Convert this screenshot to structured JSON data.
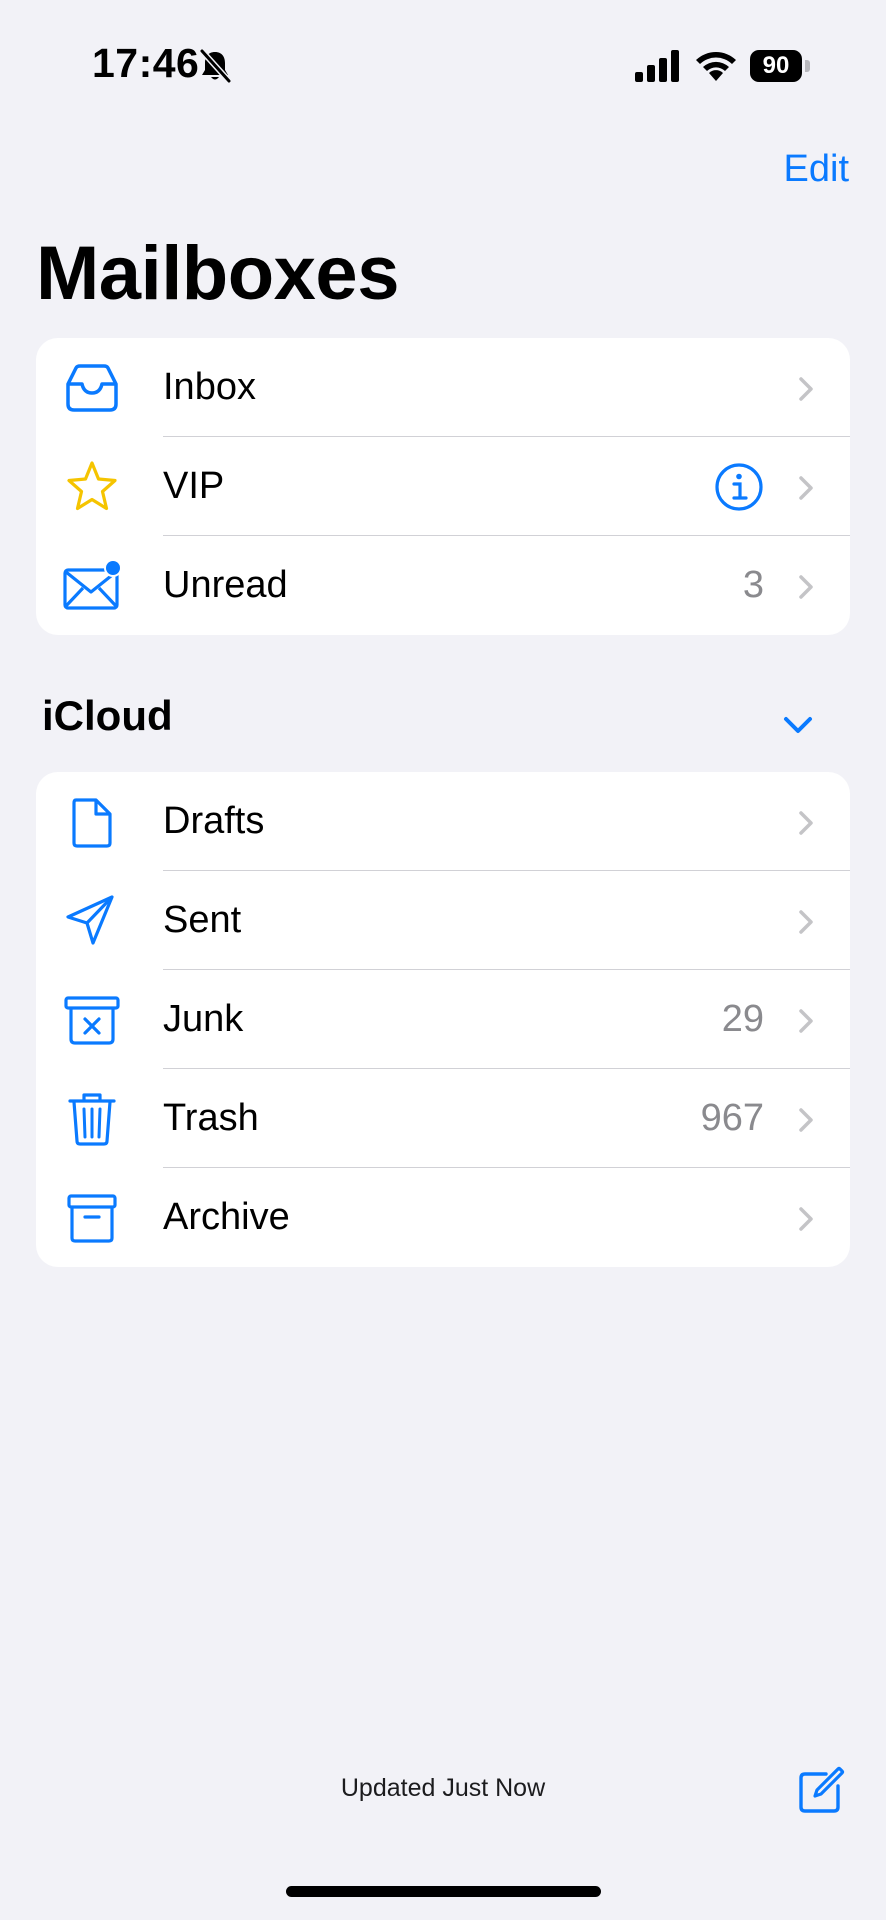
{
  "status_bar": {
    "time": "17:46",
    "battery": "90",
    "icons": [
      "bell-slash-icon",
      "cellular-signal-icon",
      "wifi-icon",
      "battery-icon"
    ]
  },
  "nav": {
    "edit_label": "Edit",
    "title": "Mailboxes"
  },
  "top_mailboxes": [
    {
      "label": "Inbox",
      "icon": "tray-icon",
      "count": ""
    },
    {
      "label": "VIP",
      "icon": "star-icon",
      "count": "",
      "accessory": "info-icon"
    },
    {
      "label": "Unread",
      "icon": "envelope-badge-icon",
      "count": "3"
    }
  ],
  "icloud": {
    "section_title": "iCloud",
    "mailboxes": [
      {
        "label": "Drafts",
        "icon": "doc-icon",
        "count": ""
      },
      {
        "label": "Sent",
        "icon": "paperplane-icon",
        "count": ""
      },
      {
        "label": "Junk",
        "icon": "xmark-bin-icon",
        "count": "29"
      },
      {
        "label": "Trash",
        "icon": "trash-icon",
        "count": "967"
      },
      {
        "label": "Archive",
        "icon": "archivebox-icon",
        "count": ""
      }
    ]
  },
  "toolbar": {
    "status": "Updated Just Now",
    "compose_icon": "square-and-pencil-icon"
  },
  "colors": {
    "accent": "#0a7aff",
    "vip_star": "#f5c400",
    "background": "#f2f2f7",
    "secondary_text": "#8a8a8e"
  }
}
